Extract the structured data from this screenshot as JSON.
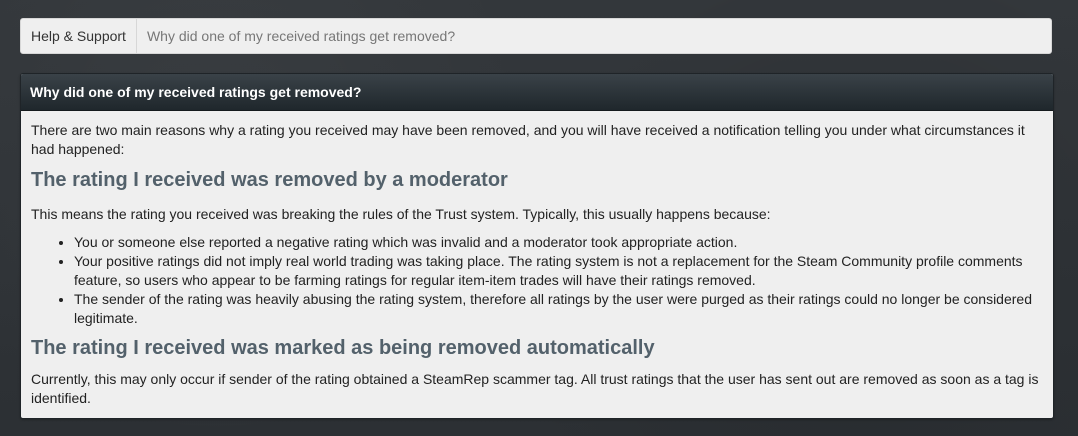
{
  "breadcrumb": {
    "home_label": "Help & Support",
    "current_label": "Why did one of my received ratings get removed?"
  },
  "article": {
    "title": "Why did one of my received ratings get removed?",
    "intro": "There are two main reasons why a rating you received may have been removed, and you will have received a notification telling you under what circumstances it had happened:",
    "sections": [
      {
        "title": "The rating I received was removed by a moderator",
        "lead": "This means the rating you received was breaking the rules of the Trust system. Typically, this usually happens because:",
        "bullets": [
          "You or someone else reported a negative rating which was invalid and a moderator took appropriate action.",
          "Your positive ratings did not imply real world trading was taking place. The rating system is not a replacement for the Steam Community profile comments feature, so users who appear to be farming ratings for regular item-item trades will have their ratings removed.",
          "The sender of the rating was heavily abusing the rating system, therefore all ratings by the user were purged as their ratings could no longer be considered legitimate."
        ]
      },
      {
        "title": "The rating I received was marked as being removed automatically",
        "body": "Currently, this may only occur if sender of the rating obtained a SteamRep scammer tag. All trust ratings that the user has sent out are removed as soon as a tag is identified."
      }
    ]
  }
}
